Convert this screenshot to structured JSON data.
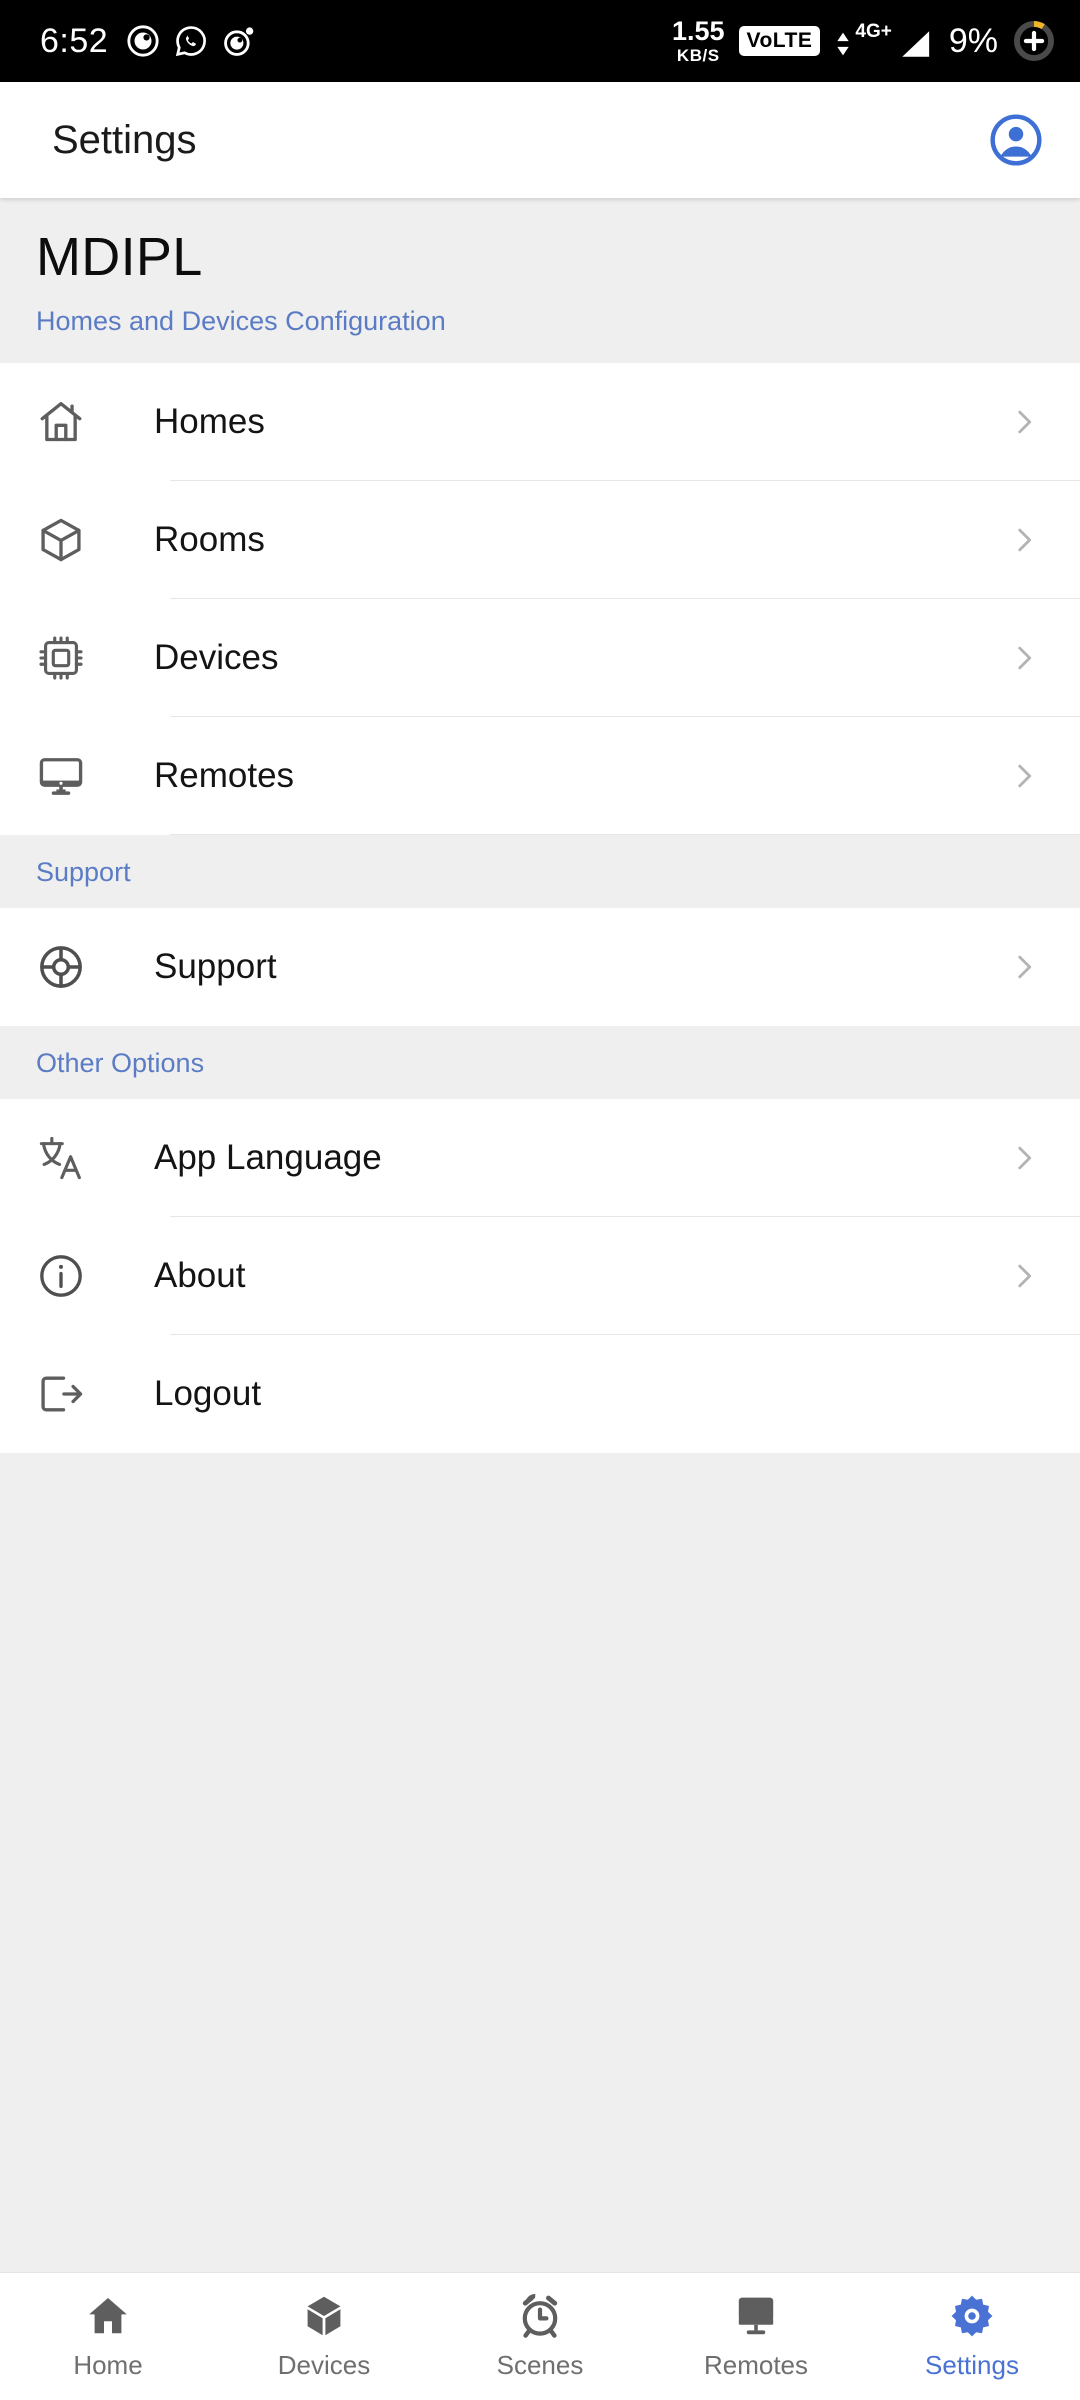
{
  "statusbar": {
    "time": "6:52",
    "notification_icons": [
      "camera-app-icon",
      "whatsapp-icon",
      "location-app-icon"
    ],
    "net_speed_value": "1.55",
    "net_speed_unit": "KB/S",
    "volte_label": "VoLTE",
    "network_type": "4G+",
    "battery_percent": "9%",
    "battery_icon": "charging-battery-icon"
  },
  "appbar": {
    "title": "Settings",
    "account_icon": "account-circle-icon"
  },
  "org": {
    "name": "MDIPL",
    "subtitle": "Homes and Devices Configuration"
  },
  "sections": [
    {
      "header": "",
      "items": [
        {
          "label": "Homes",
          "icon": "house-outline-icon",
          "chevron": true
        },
        {
          "label": "Rooms",
          "icon": "cube-outline-icon",
          "chevron": true
        },
        {
          "label": "Devices",
          "icon": "microchip-icon",
          "chevron": true
        },
        {
          "label": "Remotes",
          "icon": "monitor-icon",
          "chevron": true
        }
      ]
    },
    {
      "header": "Support",
      "items": [
        {
          "label": "Support",
          "icon": "lifebuoy-icon",
          "chevron": true
        }
      ]
    },
    {
      "header": "Other Options",
      "items": [
        {
          "label": "App Language",
          "icon": "translate-icon",
          "chevron": true
        },
        {
          "label": "About",
          "icon": "info-circle-icon",
          "chevron": true
        },
        {
          "label": "Logout",
          "icon": "logout-icon",
          "chevron": false
        }
      ]
    }
  ],
  "bottomnav": {
    "items": [
      {
        "label": "Home",
        "icon": "home-filled-icon",
        "active": false
      },
      {
        "label": "Devices",
        "icon": "cube-filled-icon",
        "active": false
      },
      {
        "label": "Scenes",
        "icon": "alarm-clock-icon",
        "active": false
      },
      {
        "label": "Remotes",
        "icon": "monitor-filled-icon",
        "active": false
      },
      {
        "label": "Settings",
        "icon": "gear-icon",
        "active": true
      }
    ]
  },
  "colors": {
    "accent_blue": "#4a72d4",
    "section_header_blue": "#5b7cc4",
    "page_background": "#efefef",
    "surface": "#ffffff",
    "icon_gray": "#5e5e5e",
    "chevron_gray": "#b4b4b4"
  }
}
